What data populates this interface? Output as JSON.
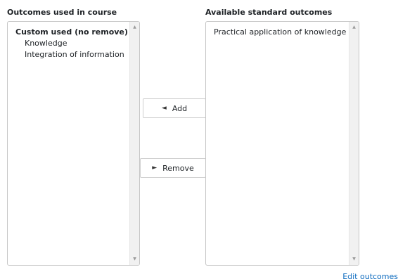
{
  "used": {
    "label": "Outcomes used in course",
    "group_label": "Custom used (no remove)",
    "items": [
      "Knowledge",
      "Integration of information"
    ]
  },
  "available": {
    "label": "Available standard outcomes",
    "items": [
      "Practical application of knowledge"
    ]
  },
  "buttons": {
    "add_icon": "arrow-left-icon",
    "add_glyph": "◄",
    "add_label": "Add",
    "remove_icon": "arrow-right-icon",
    "remove_glyph": "►",
    "remove_label": "Remove"
  },
  "scroll": {
    "up_glyph": "▲",
    "down_glyph": "▼"
  },
  "links": {
    "edit_outcomes": "Edit outcomes"
  },
  "colors": {
    "link": "#0f6cbf",
    "border": "#c7c7c7",
    "scrollbar": "#f1f1f1"
  }
}
